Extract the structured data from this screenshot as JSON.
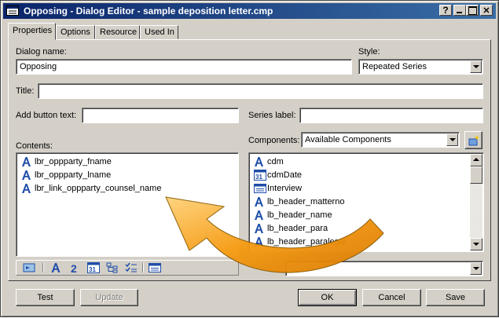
{
  "window": {
    "title": "Opposing - Dialog Editor - sample deposition letter.cmp"
  },
  "tabs": [
    {
      "label": "Properties",
      "active": true
    },
    {
      "label": "Options"
    },
    {
      "label": "Resource"
    },
    {
      "label": "Used In"
    }
  ],
  "form": {
    "dialog_name_label": "Dialog name:",
    "dialog_name_value": "Opposing",
    "style_label": "Style:",
    "style_value": "Repeated Series",
    "title_label": "Title:",
    "title_value": "",
    "add_button_text_label": "Add button text:",
    "add_button_text_value": "",
    "series_label_label": "Series label:",
    "series_label_value": "",
    "contents_label": "Contents:",
    "components_label": "Components:",
    "components_filter": "Available Components"
  },
  "contents_items": [
    {
      "label": "lbr_oppparty_fname",
      "icon": "text-field-icon"
    },
    {
      "label": "lbr_oppparty_lname",
      "icon": "text-field-icon"
    },
    {
      "label": "lbr_link_oppparty_counsel_name",
      "icon": "text-field-icon"
    }
  ],
  "components_items": [
    {
      "label": "cdm",
      "icon": "text-field-icon"
    },
    {
      "label": "cdmDate",
      "icon": "date-field-icon"
    },
    {
      "label": "Interview",
      "icon": "dialog-icon"
    },
    {
      "label": "lb_header_matterno",
      "icon": "text-field-icon"
    },
    {
      "label": "lb_header_name",
      "icon": "text-field-icon"
    },
    {
      "label": "lb_header_para",
      "icon": "text-field-icon"
    },
    {
      "label": "lb_header_paralegal",
      "icon": "text-field-icon"
    }
  ],
  "buttons": {
    "test": "Test",
    "update": "Update",
    "ok": "OK",
    "cancel": "Cancel",
    "save": "Save"
  },
  "colors": {
    "titlebar_start": "#0a246a",
    "titlebar_end": "#3a6ea5",
    "face": "#d4d0c8",
    "icon_blue": "#1f4ea8",
    "arrow_orange": "#f59a10"
  }
}
